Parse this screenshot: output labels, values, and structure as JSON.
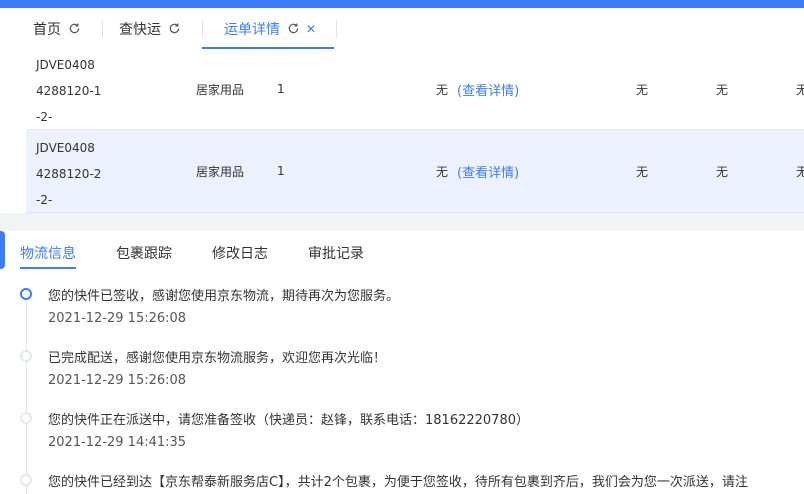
{
  "tabs": [
    {
      "label": "首页"
    },
    {
      "label": "查快运"
    },
    {
      "label": "运单详情"
    }
  ],
  "icons": {
    "refresh": "refresh-icon",
    "close": "close-icon"
  },
  "colors": {
    "accent": "#3f7cf4",
    "row_highlight": "#ecf1fd"
  },
  "table": {
    "rows": [
      {
        "code": [
          "JDVE0408",
          "4288120-1",
          "-2-"
        ],
        "category": "居家用品",
        "qty": "1",
        "c4": "无",
        "detail_link": "(查看详情)",
        "c6": "无",
        "c7": "无",
        "c8": "无"
      },
      {
        "code": [
          "JDVE0408",
          "4288120-2",
          "-2-"
        ],
        "category": "居家用品",
        "qty": "1",
        "c4": "无",
        "detail_link": "(查看详情)",
        "c6": "无",
        "c7": "无",
        "c8": "无"
      }
    ]
  },
  "panel_tabs": [
    {
      "label": "物流信息"
    },
    {
      "label": "包裹跟踪"
    },
    {
      "label": "修改日志"
    },
    {
      "label": "审批记录"
    }
  ],
  "timeline": [
    {
      "text": "您的快件已签收，感谢您使用京东物流，期待再次为您服务。",
      "time": "2021-12-29 15:26:08"
    },
    {
      "text": "已完成配送，感谢您使用京东物流服务，欢迎您再次光临！",
      "time": "2021-12-29 15:26:08"
    },
    {
      "text": "您的快件正在派送中，请您准备签收（快递员：赵锋，联系电话：18162220780）",
      "time": "2021-12-29 14:41:35"
    },
    {
      "text": "您的快件已经到达【京东帮泰新服务店C】，共计2个包裹，为便于您签收，待所有包裹到齐后，我们会为您一次派送，请注",
      "time": ""
    }
  ]
}
